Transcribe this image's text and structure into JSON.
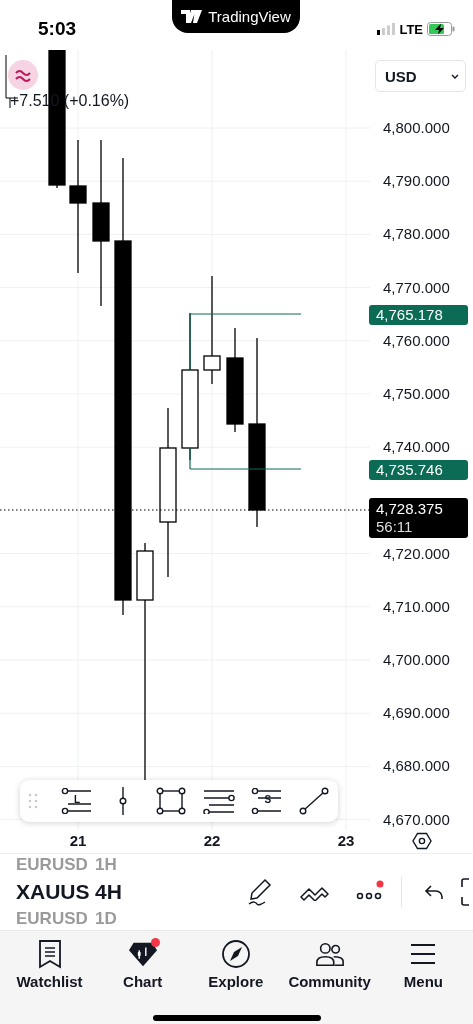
{
  "status_bar": {
    "time": "5:03",
    "app_title": "TradingView",
    "network": "LTE"
  },
  "chart": {
    "change": "+7.510 (+0.16%)",
    "currency": "USD",
    "price_ticks": [
      "4,800.000",
      "4,790.000",
      "4,780.000",
      "4,770.000",
      "4,760.000",
      "4,750.000",
      "4,740.000",
      "4,720.000",
      "4,710.000",
      "4,700.000",
      "4,690.000",
      "4,680.000",
      "4,670.000"
    ],
    "price_markers": [
      {
        "kind": "level",
        "label": "4,765.178"
      },
      {
        "kind": "level",
        "label": "4,735.746"
      },
      {
        "kind": "last",
        "label": "4,728.375",
        "countdown": "56:11"
      }
    ],
    "date_labels": [
      "21",
      "22",
      "23"
    ]
  },
  "drawing_tools": [
    {
      "kind": "long",
      "label": "L"
    },
    {
      "kind": "vline"
    },
    {
      "kind": "rect"
    },
    {
      "kind": "parallel"
    },
    {
      "kind": "short",
      "label": "S"
    },
    {
      "kind": "trend"
    }
  ],
  "symbol_bar": {
    "symbols": [
      {
        "text": "EURUSD",
        "selected": false
      },
      {
        "text": "XAUUS",
        "selected": true
      },
      {
        "text": "EURUSD",
        "selected": false
      }
    ],
    "intervals": [
      {
        "text": "1H",
        "selected": false
      },
      {
        "text": "4H",
        "selected": true
      },
      {
        "text": "1D",
        "selected": false
      }
    ]
  },
  "tab_bar": [
    {
      "label": "Watchlist",
      "badge": false
    },
    {
      "label": "Chart",
      "badge": true
    },
    {
      "label": "Explore",
      "badge": false
    },
    {
      "label": "Community",
      "badge": false
    },
    {
      "label": "Menu",
      "badge": false
    }
  ]
}
